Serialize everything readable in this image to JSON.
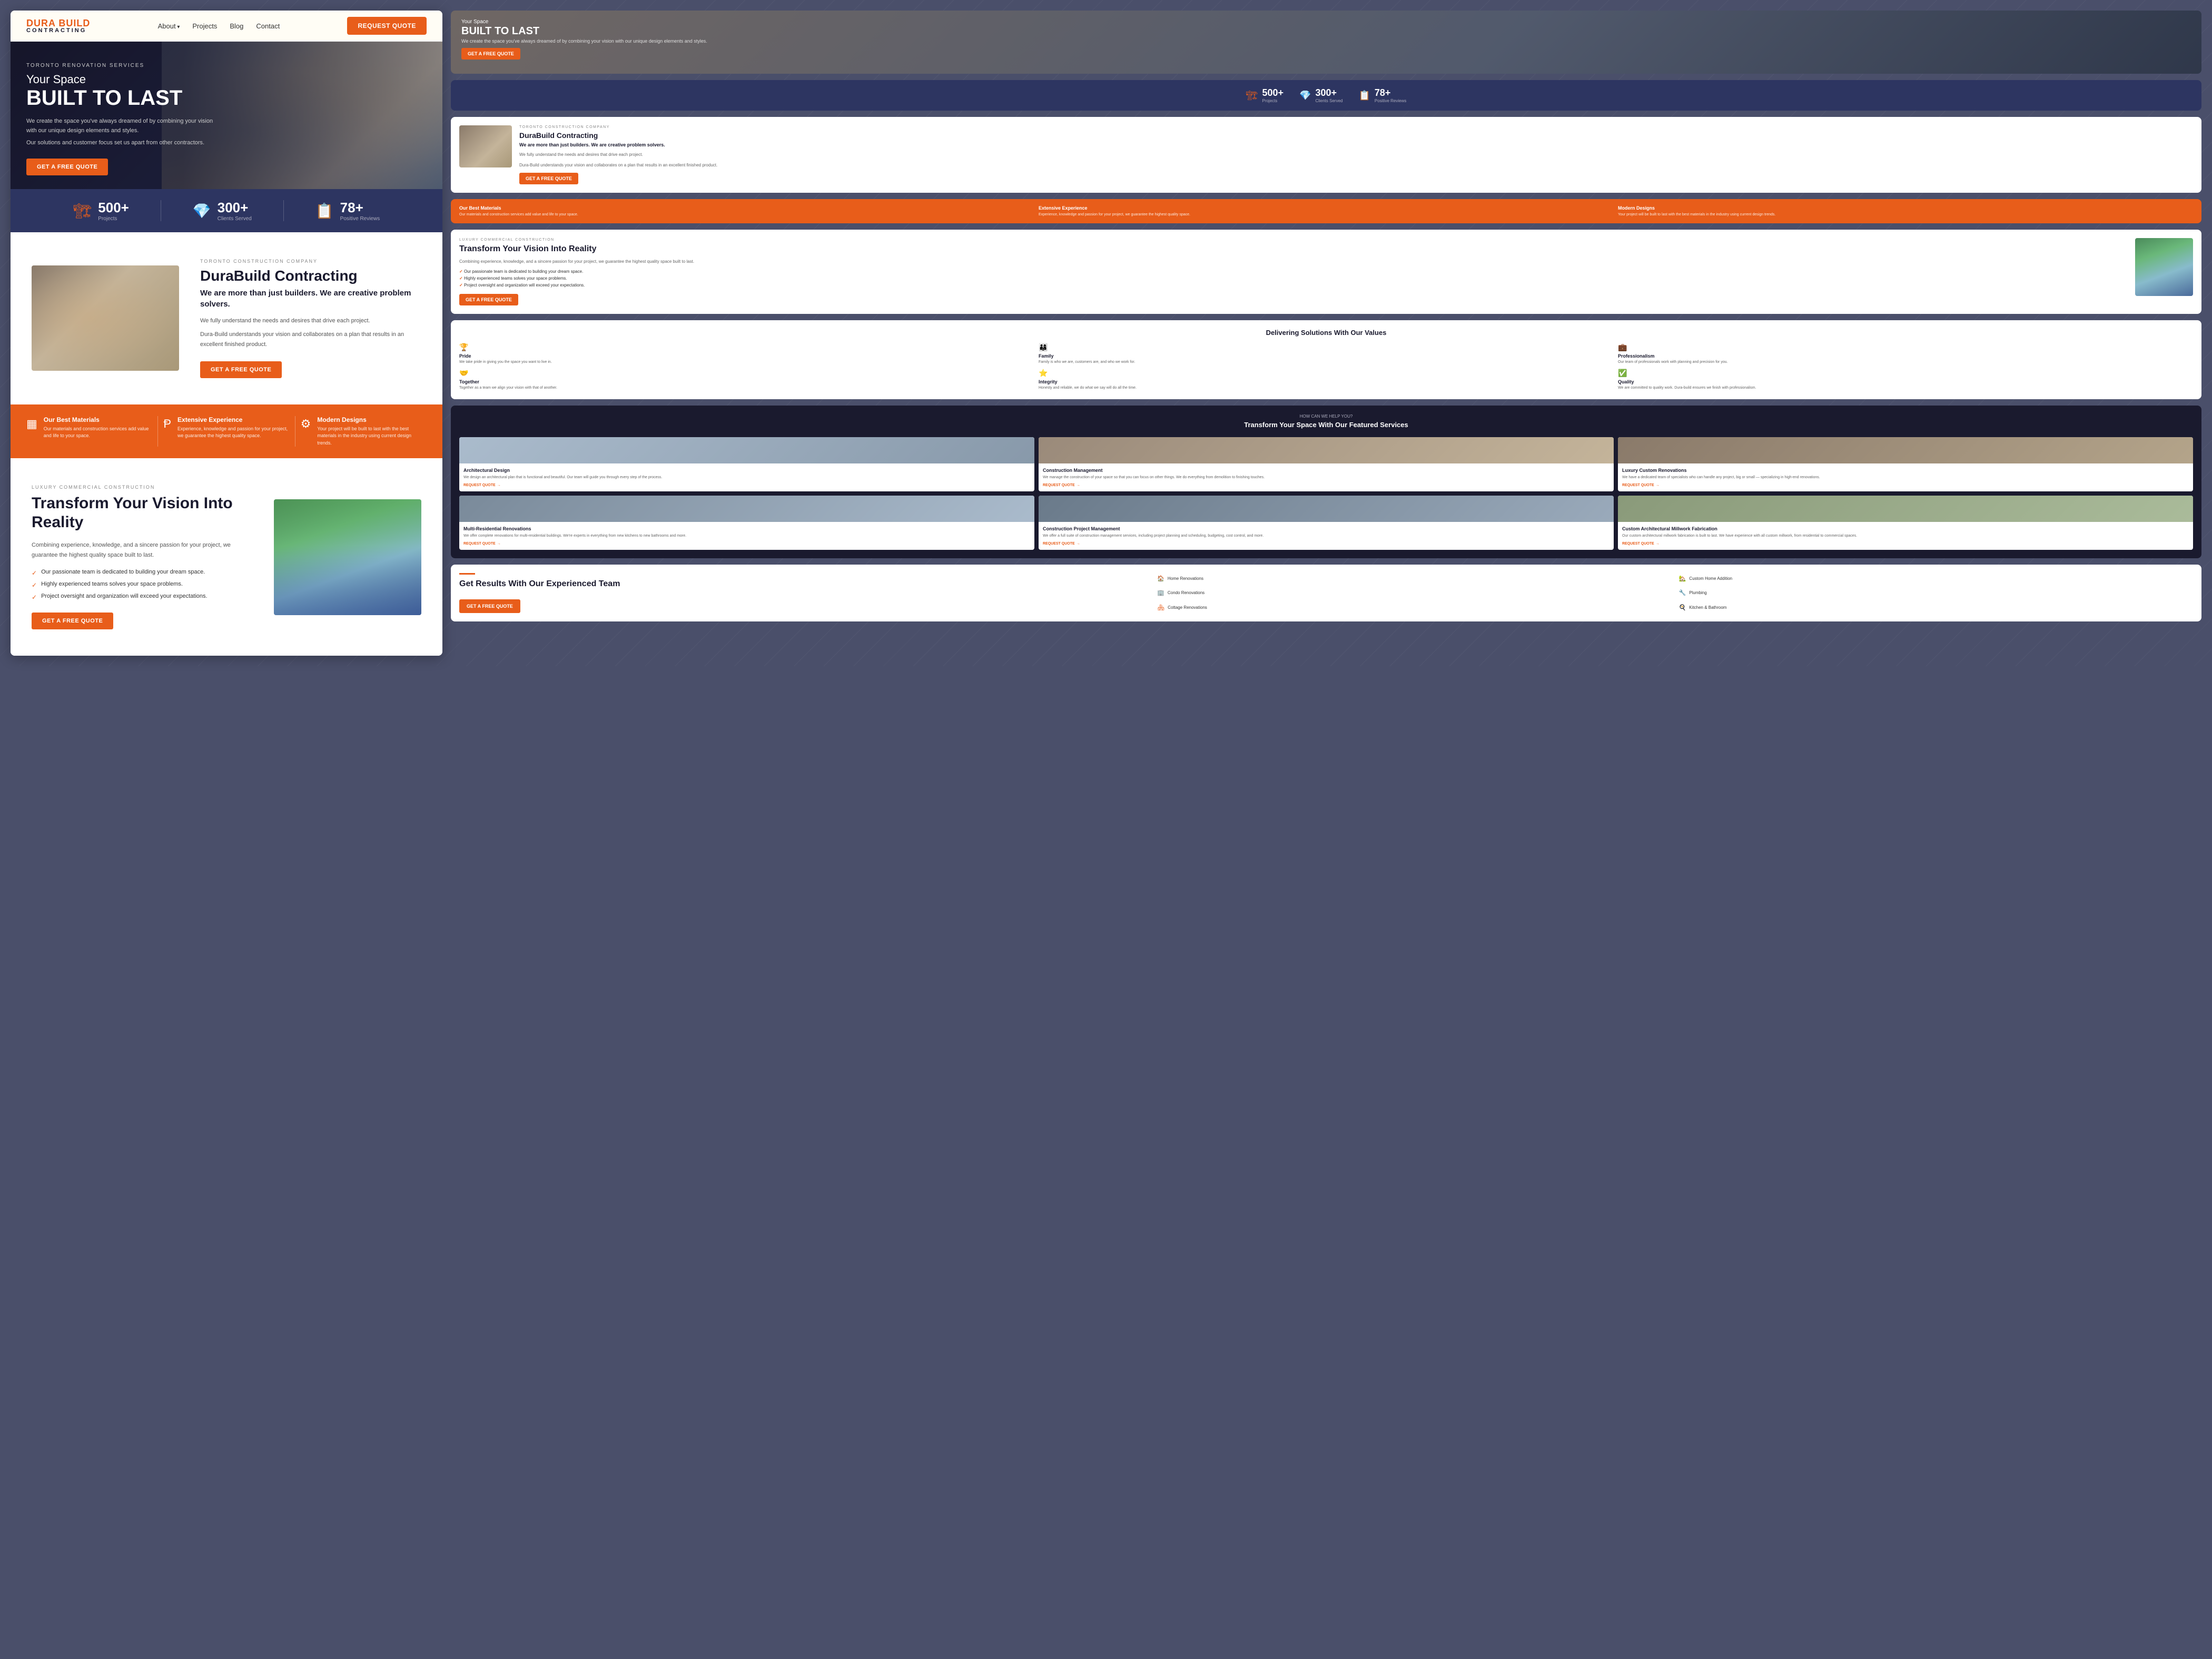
{
  "brand": {
    "dura": "DURA BUILD",
    "contracting": "CONTRACTING",
    "logo_top": "DURA BUILD",
    "logo_bottom": "CONTRACTING"
  },
  "navbar": {
    "links": [
      "About",
      "Projects",
      "Blog",
      "Contact"
    ],
    "cta": "REQUEST QUOTE"
  },
  "hero": {
    "eyebrow": "TORONTO RENOVATION SERVICES",
    "title_line1": "Your Space",
    "title_line2": "BUILT TO LAST",
    "desc1": "We create the space you've always dreamed of by combining your vision with our unique design elements and styles.",
    "desc2": "Our solutions and customer focus set us apart from other contractors.",
    "cta": "GET A FREE QUOTE"
  },
  "stats": {
    "projects_num": "500+",
    "projects_label": "Projects",
    "clients_num": "300+",
    "clients_label": "Clients Served",
    "reviews_num": "78+",
    "reviews_label": "Positive Reviews"
  },
  "about": {
    "eyebrow": "TORONTO CONSTRUCTION COMPANY",
    "title": "DuraBuild Contracting",
    "subtitle": "We are more than just builders. We are creative problem solvers.",
    "desc1": "We fully understand the needs and desires that drive each project.",
    "desc2": "Dura-Build understands your vision and collaborates on a plan that results in an excellent finished product.",
    "cta": "GET A FREE QUOTE"
  },
  "features": {
    "items": [
      {
        "title": "Our Best Materials",
        "desc": "Our materials and construction services add value and life to your space."
      },
      {
        "title": "Extensive Experience",
        "desc": "Experience, knowledge and passion for your project, we guarantee the highest quality space."
      },
      {
        "title": "Modern Designs",
        "desc": "Your project will be built to last with the best materials in the industry using current design trends."
      }
    ]
  },
  "vision": {
    "eyebrow": "LUXURY COMMERCIAL CONSTRUCTION",
    "title": "Transform Your Vision Into Reality",
    "desc": "Combining experience, knowledge, and a sincere passion for your project, we guarantee the highest quality space built to last.",
    "checks": [
      "Our passionate team is dedicated to building your dream space.",
      "Highly experienced teams solves your space problems.",
      "Project oversight and organization will exceed your expectations."
    ],
    "cta": "GET A FREE QUOTE"
  },
  "values": {
    "heading": "Delivering Solutions With Our Values",
    "items": [
      {
        "name": "Pride",
        "desc": "We take pride in giving you the space you want to live in."
      },
      {
        "name": "Family",
        "desc": "Family is who we are, customers are, and who we work for."
      },
      {
        "name": "Professionalism",
        "desc": "Our team of professionals work with planning and precision for you."
      },
      {
        "name": "Together",
        "desc": "Together as a team we align your vision with that of another."
      },
      {
        "name": "Integrity",
        "desc": "Honesty and reliable, we do what we say will do all the time."
      },
      {
        "name": "Quality",
        "desc": "We are committed to quality work. Dura-build ensures we finish with professionalism."
      }
    ]
  },
  "services": {
    "eyebrow": "HOW CAN WE HELP YOU?",
    "title": "Transform Your Space With Our Featured Services",
    "items": [
      {
        "name": "Architectural Design",
        "desc": "We design an architectural plan that is functional and beautiful. Our team will guide you through every step of the process.",
        "cta": "REQUEST QUOTE"
      },
      {
        "name": "Construction Management",
        "desc": "We manage the construction of your space so that you can focus on other things. We do everything from demolition to finishing touches.",
        "cta": "REQUEST QUOTE"
      },
      {
        "name": "Luxury Custom Renovations",
        "desc": "We have a dedicated team of specialists who can handle any project, big or small — specializing in high-end renovations.",
        "cta": "REQUEST QUOTE"
      },
      {
        "name": "Multi-Residential Renovations",
        "desc": "We offer complete renovations for multi-residential buildings. We're experts in everything from new kitchens to new bathrooms and more.",
        "cta": "REQUEST QUOTE"
      },
      {
        "name": "Construction Project Management",
        "desc": "We offer a full suite of construction management services, including project planning and scheduling, budgeting, cost control, and more.",
        "cta": "REQUEST QUOTE"
      },
      {
        "name": "Custom Architectural Millwork Fabrication",
        "desc": "Our custom architectural millwork fabrication is built to last. We have experience with all custom millwork, from residential to commercial spaces.",
        "cta": "REQUEST QUOTE"
      }
    ]
  },
  "results": {
    "title": "Get Results With Our Experienced Team",
    "cta": "GET A FREE QUOTE",
    "services": [
      "Home Renovations",
      "Custom Home Addition",
      "Condo Renovations",
      "Plumbing",
      "Cottage Renovations",
      "Kitchen & Bathroom"
    ]
  }
}
